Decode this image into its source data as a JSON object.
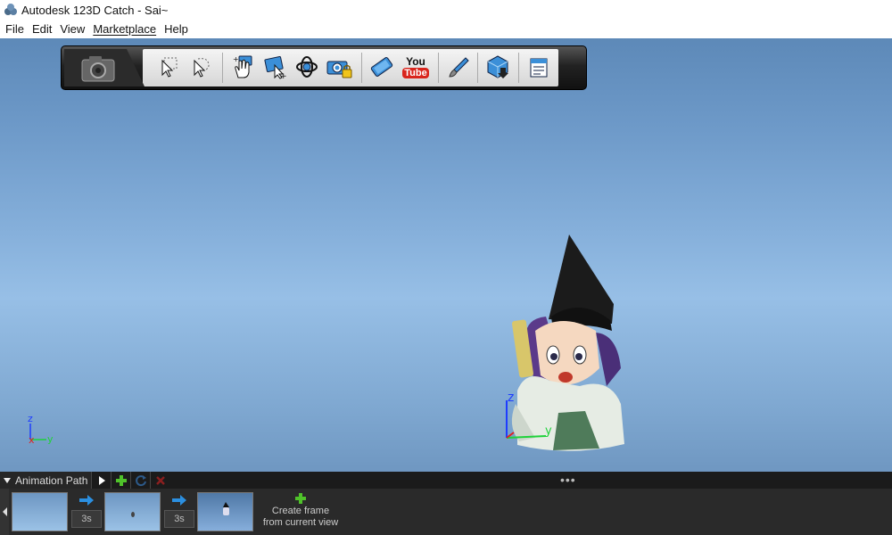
{
  "window": {
    "title": "Autodesk 123D Catch - Sai~"
  },
  "menu": [
    "File",
    "Edit",
    "View",
    "Marketplace",
    "Help"
  ],
  "toolbar": {
    "buttons": [
      {
        "name": "select-arrow-icon"
      },
      {
        "name": "lasso-select-icon"
      },
      {
        "name": "pan-hand-icon"
      },
      {
        "name": "zoom-add-icon"
      },
      {
        "name": "orbit-icon"
      },
      {
        "name": "lock-camera-icon"
      },
      {
        "name": "video-clip-icon"
      },
      {
        "name": "youtube-icon"
      },
      {
        "name": "brush-icon"
      },
      {
        "name": "export-mesh-icon"
      },
      {
        "name": "settings-sheet-icon"
      }
    ],
    "youtube_you": "You",
    "youtube_tube": "Tube"
  },
  "axes": {
    "z": "z",
    "x": "x",
    "y": "y"
  },
  "animation": {
    "tab_label": "Animation Path",
    "dots": "•••",
    "transitions": [
      "3s",
      "3s"
    ],
    "create_line1": "Create frame",
    "create_line2": "from current view"
  },
  "colors": {
    "accent_green": "#4fc22a",
    "axis_blue": "#1e3cff",
    "axis_red": "#e02020",
    "axis_green": "#1fd23a"
  }
}
